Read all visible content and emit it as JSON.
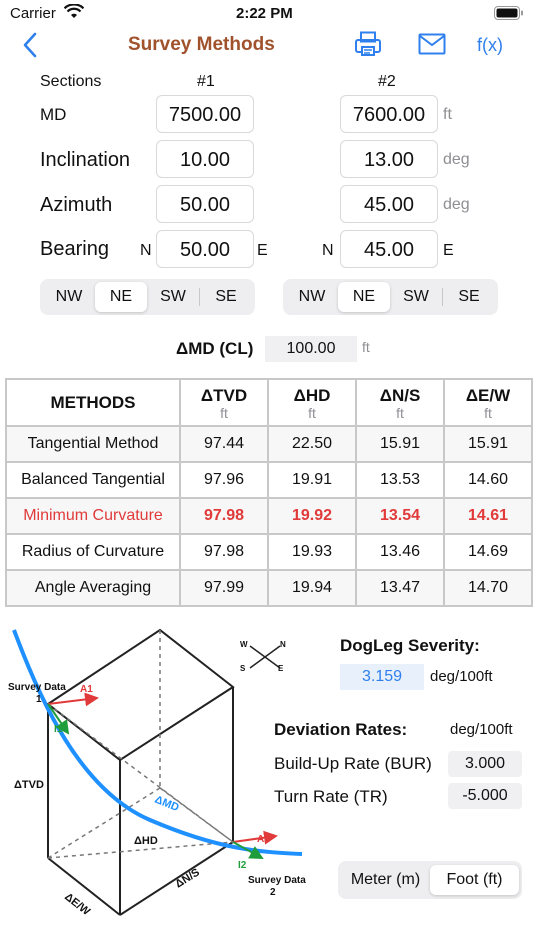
{
  "status": {
    "carrier": "Carrier",
    "time": "2:22 PM"
  },
  "nav": {
    "title": "Survey Methods",
    "fx_label": "f(x)",
    "back_icon": "chevron-left-icon",
    "print_icon": "printer-icon",
    "mail_icon": "envelope-icon"
  },
  "sections": {
    "label": "Sections",
    "col1": "#1",
    "col2": "#2",
    "md": {
      "label": "MD",
      "v1": "7500.00",
      "v2": "7600.00",
      "unit": "ft"
    },
    "inclination": {
      "label": "Inclination",
      "v1": "10.00",
      "v2": "13.00",
      "unit": "deg"
    },
    "azimuth": {
      "label": "Azimuth",
      "v1": "50.00",
      "v2": "45.00",
      "unit": "deg"
    },
    "bearing": {
      "label": "Bearing",
      "prefix1": "N",
      "v1": "50.00",
      "suffix1": "E",
      "prefix2": "N",
      "v2": "45.00",
      "suffix2": "E"
    }
  },
  "quadrants": {
    "options": [
      "NW",
      "NE",
      "SW",
      "SE"
    ],
    "selected1": "NE",
    "selected2": "NE"
  },
  "dmd": {
    "label": "ΔMD (CL)",
    "value": "100.00",
    "unit": "ft"
  },
  "table": {
    "headers": [
      {
        "main": "METHODS",
        "unit": ""
      },
      {
        "main": "ΔTVD",
        "unit": "ft"
      },
      {
        "main": "ΔHD",
        "unit": "ft"
      },
      {
        "main": "ΔN/S",
        "unit": "ft"
      },
      {
        "main": "ΔE/W",
        "unit": "ft"
      }
    ],
    "rows": [
      [
        "Tangential Method",
        "97.44",
        "22.50",
        "15.91",
        "15.91"
      ],
      [
        "Balanced Tangential",
        "97.96",
        "19.91",
        "13.53",
        "14.60"
      ],
      [
        "Minimum Curvature",
        "97.98",
        "19.92",
        "13.54",
        "14.61"
      ],
      [
        "Radius of Curvature",
        "97.98",
        "19.93",
        "13.46",
        "14.69"
      ],
      [
        "Angle Averaging",
        "97.99",
        "19.94",
        "13.47",
        "14.70"
      ]
    ],
    "highlight_color": "#e03a3a"
  },
  "diagram": {
    "survey1": "Survey Data",
    "survey1_num": "1",
    "survey2": "Survey Data",
    "survey2_num": "2",
    "a1": "A1",
    "a2": "A2",
    "i1": "I1",
    "i2": "I2",
    "tvd": "ΔTVD",
    "md": "ΔMD",
    "hd": "ΔHD",
    "ns": "ΔN/S",
    "ew": "ΔE/W",
    "compass": {
      "w": "W",
      "n": "N",
      "s": "S",
      "e": "E"
    }
  },
  "dogleg": {
    "label": "DogLeg Severity:",
    "value": "3.159",
    "unit": "deg/100ft"
  },
  "deviation": {
    "label": "Deviation Rates:",
    "unit": "deg/100ft",
    "bur_label": "Build-Up Rate (BUR)",
    "bur_value": "3.000",
    "tr_label": "Turn Rate (TR)",
    "tr_value": "-5.000"
  },
  "units_toggle": {
    "meter": "Meter (m)",
    "foot": "Foot (ft)",
    "selected": "foot"
  },
  "colors": {
    "accent": "#2f80ed",
    "title": "#a0522d",
    "curve": "#1e90ff",
    "arrow_red": "#e03a3a",
    "arrow_green": "#1f9d3a"
  }
}
